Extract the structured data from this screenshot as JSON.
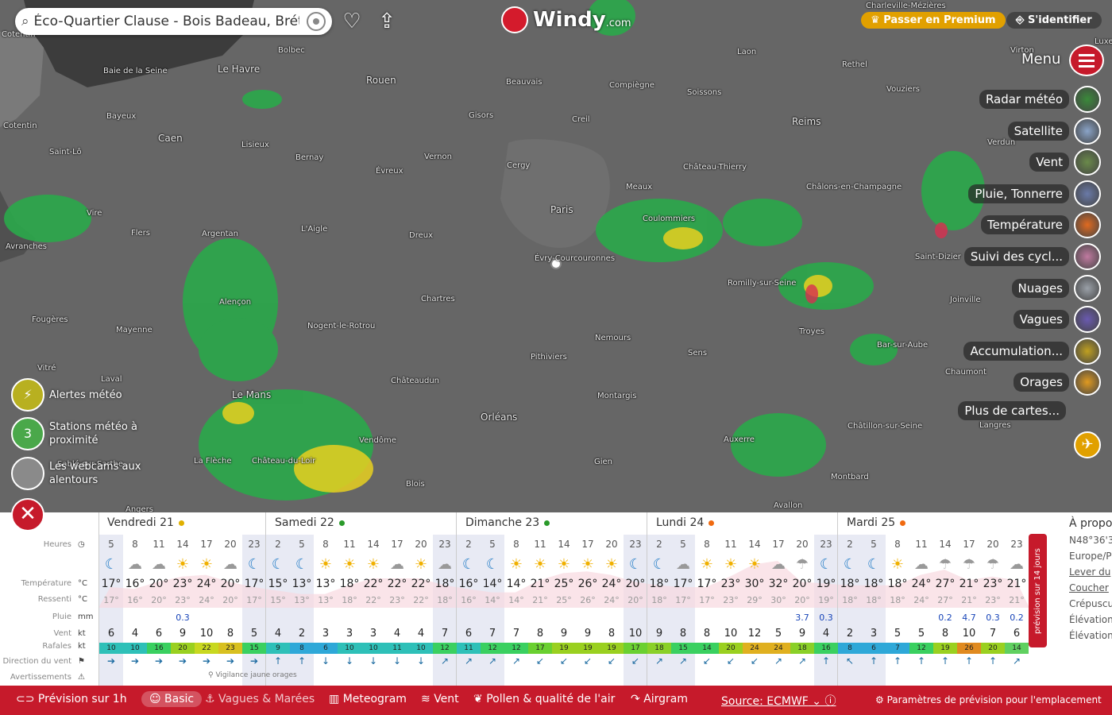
{
  "search": {
    "query": "Éco-Quartier Clause - Bois Badeau, Brétigny-sur-Orge"
  },
  "logo": {
    "name": "Windy",
    "domain": ".com"
  },
  "header": {
    "premium": "Passer en Premium",
    "login": "S'identifier",
    "menu": "Menu"
  },
  "layers": [
    {
      "label": "Radar météo",
      "color": "#3a8a3a"
    },
    {
      "label": "Satellite",
      "color": "#8aa4c8"
    },
    {
      "label": "Vent",
      "color": "#6a8a4a"
    },
    {
      "label": "Pluie, Tonnerre",
      "color": "#6a7aa8"
    },
    {
      "label": "Température",
      "color": "#e06a20"
    },
    {
      "label": "Suivi des cycl...",
      "color": "#c07aa0"
    },
    {
      "label": "Nuages",
      "color": "#9aa0a8"
    },
    {
      "label": "Vagues",
      "color": "#6a5ab0"
    },
    {
      "label": "Accumulation...",
      "color": "#c0a020"
    },
    {
      "label": "Orages",
      "color": "#e09a20"
    },
    {
      "label": "Plus de cartes...",
      "color": ""
    }
  ],
  "side": {
    "alerts": "Alertes météo",
    "stations_count": "3",
    "stations": [
      "Stations météo à",
      "proximité"
    ],
    "webcams": [
      "Les webcams aux",
      "alentours"
    ]
  },
  "cities": [
    {
      "n": "Le Havre",
      "big": true
    },
    {
      "n": "Rouen",
      "big": true
    },
    {
      "n": "Caen",
      "big": true
    },
    {
      "n": "Paris",
      "big": true
    },
    {
      "n": "Le Mans",
      "big": true
    },
    {
      "n": "Orléans",
      "big": true
    },
    {
      "n": "Reims",
      "big": true
    },
    {
      "n": "Bolbec"
    },
    {
      "n": "Beauvais"
    },
    {
      "n": "Compiègne"
    },
    {
      "n": "Laon"
    },
    {
      "n": "Rethel"
    },
    {
      "n": "Vouziers"
    },
    {
      "n": "Soissons"
    },
    {
      "n": "Creil"
    },
    {
      "n": "Gisors"
    },
    {
      "n": "Bayeux"
    },
    {
      "n": "Lisieux"
    },
    {
      "n": "Bernay"
    },
    {
      "n": "Évreux"
    },
    {
      "n": "Vernon"
    },
    {
      "n": "Cergy"
    },
    {
      "n": "Meaux"
    },
    {
      "n": "Château-Thierry"
    },
    {
      "n": "Châlons-en-Champagne"
    },
    {
      "n": "Verdun"
    },
    {
      "n": "Saint-Lô"
    },
    {
      "n": "Vire"
    },
    {
      "n": "Flers"
    },
    {
      "n": "Argentan"
    },
    {
      "n": "L'Aigle"
    },
    {
      "n": "Dreux"
    },
    {
      "n": "Évry-Courcouronnes"
    },
    {
      "n": "Coulommiers"
    },
    {
      "n": "Avranches"
    },
    {
      "n": "Alençon"
    },
    {
      "n": "Chartres"
    },
    {
      "n": "Romilly-sur-Seine"
    },
    {
      "n": "Saint-Dizier"
    },
    {
      "n": "Joinville"
    },
    {
      "n": "Fougères"
    },
    {
      "n": "Mayenne"
    },
    {
      "n": "Nogent-le-Rotrou"
    },
    {
      "n": "Nemours"
    },
    {
      "n": "Troyes"
    },
    {
      "n": "Pithiviers"
    },
    {
      "n": "Sens"
    },
    {
      "n": "Bar-sur-Aube"
    },
    {
      "n": "Vitré"
    },
    {
      "n": "Laval"
    },
    {
      "n": "Châteaudun"
    },
    {
      "n": "Chaumont"
    },
    {
      "n": "Montargis"
    },
    {
      "n": "Langres"
    },
    {
      "n": "Vendôme"
    },
    {
      "n": "Châtillon-sur-Seine"
    },
    {
      "n": "Auxerre"
    },
    {
      "n": "La Flèche"
    },
    {
      "n": "Château-du-Loir"
    },
    {
      "n": "Gien"
    },
    {
      "n": "Blois"
    },
    {
      "n": "Montbard"
    },
    {
      "n": "Avallon"
    },
    {
      "n": "Angers"
    },
    {
      "n": "Charleville-Mézières"
    },
    {
      "n": "Virton"
    },
    {
      "n": "Luxem"
    },
    {
      "n": "Baie de la Seine"
    },
    {
      "n": "Cotentin"
    },
    {
      "n": "Cotentin"
    },
    {
      "n": "Sablé-sur-Sarthe"
    }
  ],
  "labels": {
    "hours": "Heures",
    "temp": "Température",
    "feel": "Ressenti",
    "rain": "Pluie",
    "wind": "Vent",
    "gusts": "Rafales",
    "dir": "Direction du vent",
    "warn": "Avertissements",
    "u_temp": "°C",
    "u_rain": "mm",
    "u_wind": "kt",
    "vigilance": "Vigilance jaune orages",
    "side14": "prévision sur 14 jours"
  },
  "days": [
    {
      "name": "Vendredi 21",
      "dot": "#e0b000"
    },
    {
      "name": "Samedi 22",
      "dot": "#2a9a2a"
    },
    {
      "name": "Dimanche 23",
      "dot": "#2a9a2a"
    },
    {
      "name": "Lundi 24",
      "dot": "#f06a10"
    },
    {
      "name": "Mardi 25",
      "dot": "#f06a10"
    }
  ],
  "hours": [
    "5",
    "8",
    "11",
    "14",
    "17",
    "20",
    "23",
    "2",
    "5",
    "8",
    "11",
    "14",
    "17",
    "20",
    "23",
    "2",
    "5",
    "8",
    "11",
    "14",
    "17",
    "20",
    "23",
    "2",
    "5",
    "8",
    "11",
    "14",
    "17",
    "20",
    "23",
    "2",
    "5",
    "8",
    "11",
    "14",
    "17",
    "20",
    "23"
  ],
  "weather": [
    "☾",
    "☁",
    "☁",
    "☀",
    "☀",
    "☁",
    "☾",
    "☾",
    "☾",
    "☀",
    "☀",
    "☀",
    "☁",
    "☀",
    "☁",
    "☾",
    "☾",
    "☀",
    "☀",
    "☀",
    "☀",
    "☀",
    "☾",
    "☾",
    "☁",
    "☀",
    "☀",
    "☀",
    "☁",
    "☂",
    "☾",
    "☾",
    "☾",
    "☀",
    "☁",
    "☂",
    "☂",
    "☂",
    "☁"
  ],
  "temps": [
    "17°",
    "16°",
    "20°",
    "23°",
    "24°",
    "20°",
    "17°",
    "15°",
    "13°",
    "13°",
    "18°",
    "22°",
    "22°",
    "22°",
    "18°",
    "16°",
    "14°",
    "14°",
    "21°",
    "25°",
    "26°",
    "24°",
    "20°",
    "18°",
    "17°",
    "17°",
    "23°",
    "30°",
    "32°",
    "20°",
    "19°",
    "18°",
    "18°",
    "18°",
    "24°",
    "27°",
    "21°",
    "23°",
    "21°"
  ],
  "feels": [
    "17°",
    "16°",
    "20°",
    "23°",
    "24°",
    "20°",
    "17°",
    "15°",
    "13°",
    "13°",
    "18°",
    "22°",
    "23°",
    "22°",
    "18°",
    "16°",
    "14°",
    "14°",
    "21°",
    "25°",
    "26°",
    "24°",
    "20°",
    "18°",
    "17°",
    "17°",
    "23°",
    "29°",
    "30°",
    "20°",
    "19°",
    "18°",
    "18°",
    "18°",
    "24°",
    "27°",
    "21°",
    "23°",
    "21°"
  ],
  "rain": [
    "",
    "",
    "",
    "0.3",
    "",
    "",
    "",
    "",
    "",
    "",
    "",
    "",
    "",
    "",
    "",
    "",
    "",
    "",
    "",
    "",
    "",
    "",
    "",
    "",
    "",
    "",
    "",
    "",
    "",
    "3.7",
    "0.3",
    "",
    "",
    "",
    "",
    "0.2",
    "4.7",
    "0.3",
    "0.2"
  ],
  "wind": [
    "6",
    "4",
    "6",
    "9",
    "10",
    "8",
    "5",
    "4",
    "2",
    "3",
    "3",
    "3",
    "4",
    "4",
    "7",
    "6",
    "7",
    "7",
    "8",
    "9",
    "9",
    "8",
    "10",
    "9",
    "8",
    "8",
    "10",
    "12",
    "5",
    "9",
    "4",
    "2",
    "3",
    "5",
    "5",
    "8",
    "10",
    "7",
    "6"
  ],
  "gusts": [
    "10",
    "10",
    "16",
    "20",
    "22",
    "23",
    "15",
    "9",
    "8",
    "6",
    "10",
    "10",
    "11",
    "10",
    "12",
    "11",
    "12",
    "12",
    "17",
    "19",
    "19",
    "19",
    "17",
    "18",
    "15",
    "14",
    "20",
    "24",
    "24",
    "18",
    "16",
    "8",
    "6",
    "7",
    "12",
    "19",
    "26",
    "20",
    "14"
  ],
  "gust_colors": [
    "#2ec0b8",
    "#2ec0b8",
    "#3ad060",
    "#9ad020",
    "#c8d820",
    "#d8c020",
    "#3ad060",
    "#2ec0b8",
    "#2ea8d8",
    "#2ea8d8",
    "#2ec0b8",
    "#2ec0b8",
    "#2ec0b8",
    "#2ec0b8",
    "#3ad060",
    "#2ec0b8",
    "#3ad060",
    "#3ad060",
    "#6ad030",
    "#9ad020",
    "#9ad020",
    "#9ad020",
    "#6ad030",
    "#8ad028",
    "#3ad060",
    "#3ad060",
    "#9ad020",
    "#e0b020",
    "#e0b020",
    "#8ad028",
    "#3ad060",
    "#2ea8d8",
    "#2ea8d8",
    "#2ea8d8",
    "#3ad060",
    "#9ad020",
    "#e08a20",
    "#9ad020",
    "#60d060"
  ],
  "info": {
    "title": "À propos",
    "coords": "N48°36'3",
    "tz": "Europe/P",
    "sunrise": "Lever du",
    "sunset": "Coucher",
    "dusk": "Crépuscu",
    "elev1": "Élévation",
    "elev2": "Élévation"
  },
  "bottom": {
    "hourly": "Prévision sur 1h",
    "basic": "Basic",
    "waves": "Vagues & Marées",
    "meteogram": "Meteogram",
    "wind": "Vent",
    "pollen": "Pollen & qualité de l'air",
    "airgram": "Airgram",
    "source": "Source: ECMWF",
    "settings": "Paramètres de prévision pour l'emplacement"
  }
}
